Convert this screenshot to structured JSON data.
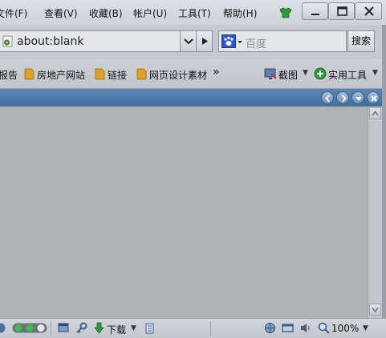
{
  "menu": {
    "items": [
      {
        "label": "文件(F)"
      },
      {
        "label": "查看(V)"
      },
      {
        "label": "收藏(B)"
      },
      {
        "label": "帐户(U)"
      },
      {
        "label": "工具(T)"
      },
      {
        "label": "帮助(H)"
      }
    ]
  },
  "window": {
    "minimize_icon": "minimize-icon",
    "maximize_icon": "maximize-icon",
    "close_icon": "close-icon"
  },
  "address": {
    "value": "about:blank"
  },
  "search": {
    "placeholder": "百度",
    "button_label": "搜索",
    "engine_icon": "baidu-paw-icon"
  },
  "favorites": {
    "items": [
      {
        "label": "报告"
      },
      {
        "label": "房地产网站"
      },
      {
        "label": "链接"
      },
      {
        "label": "网页设计素材"
      }
    ],
    "more": "»",
    "screenshot_label": "截图",
    "tools_label": "实用工具"
  },
  "status": {
    "download_label": "下载",
    "zoom": "100%"
  },
  "colors": {
    "tab_strip": "#4f79a8",
    "content_bg": "#b0b2b5",
    "folder": "#e0a020"
  }
}
